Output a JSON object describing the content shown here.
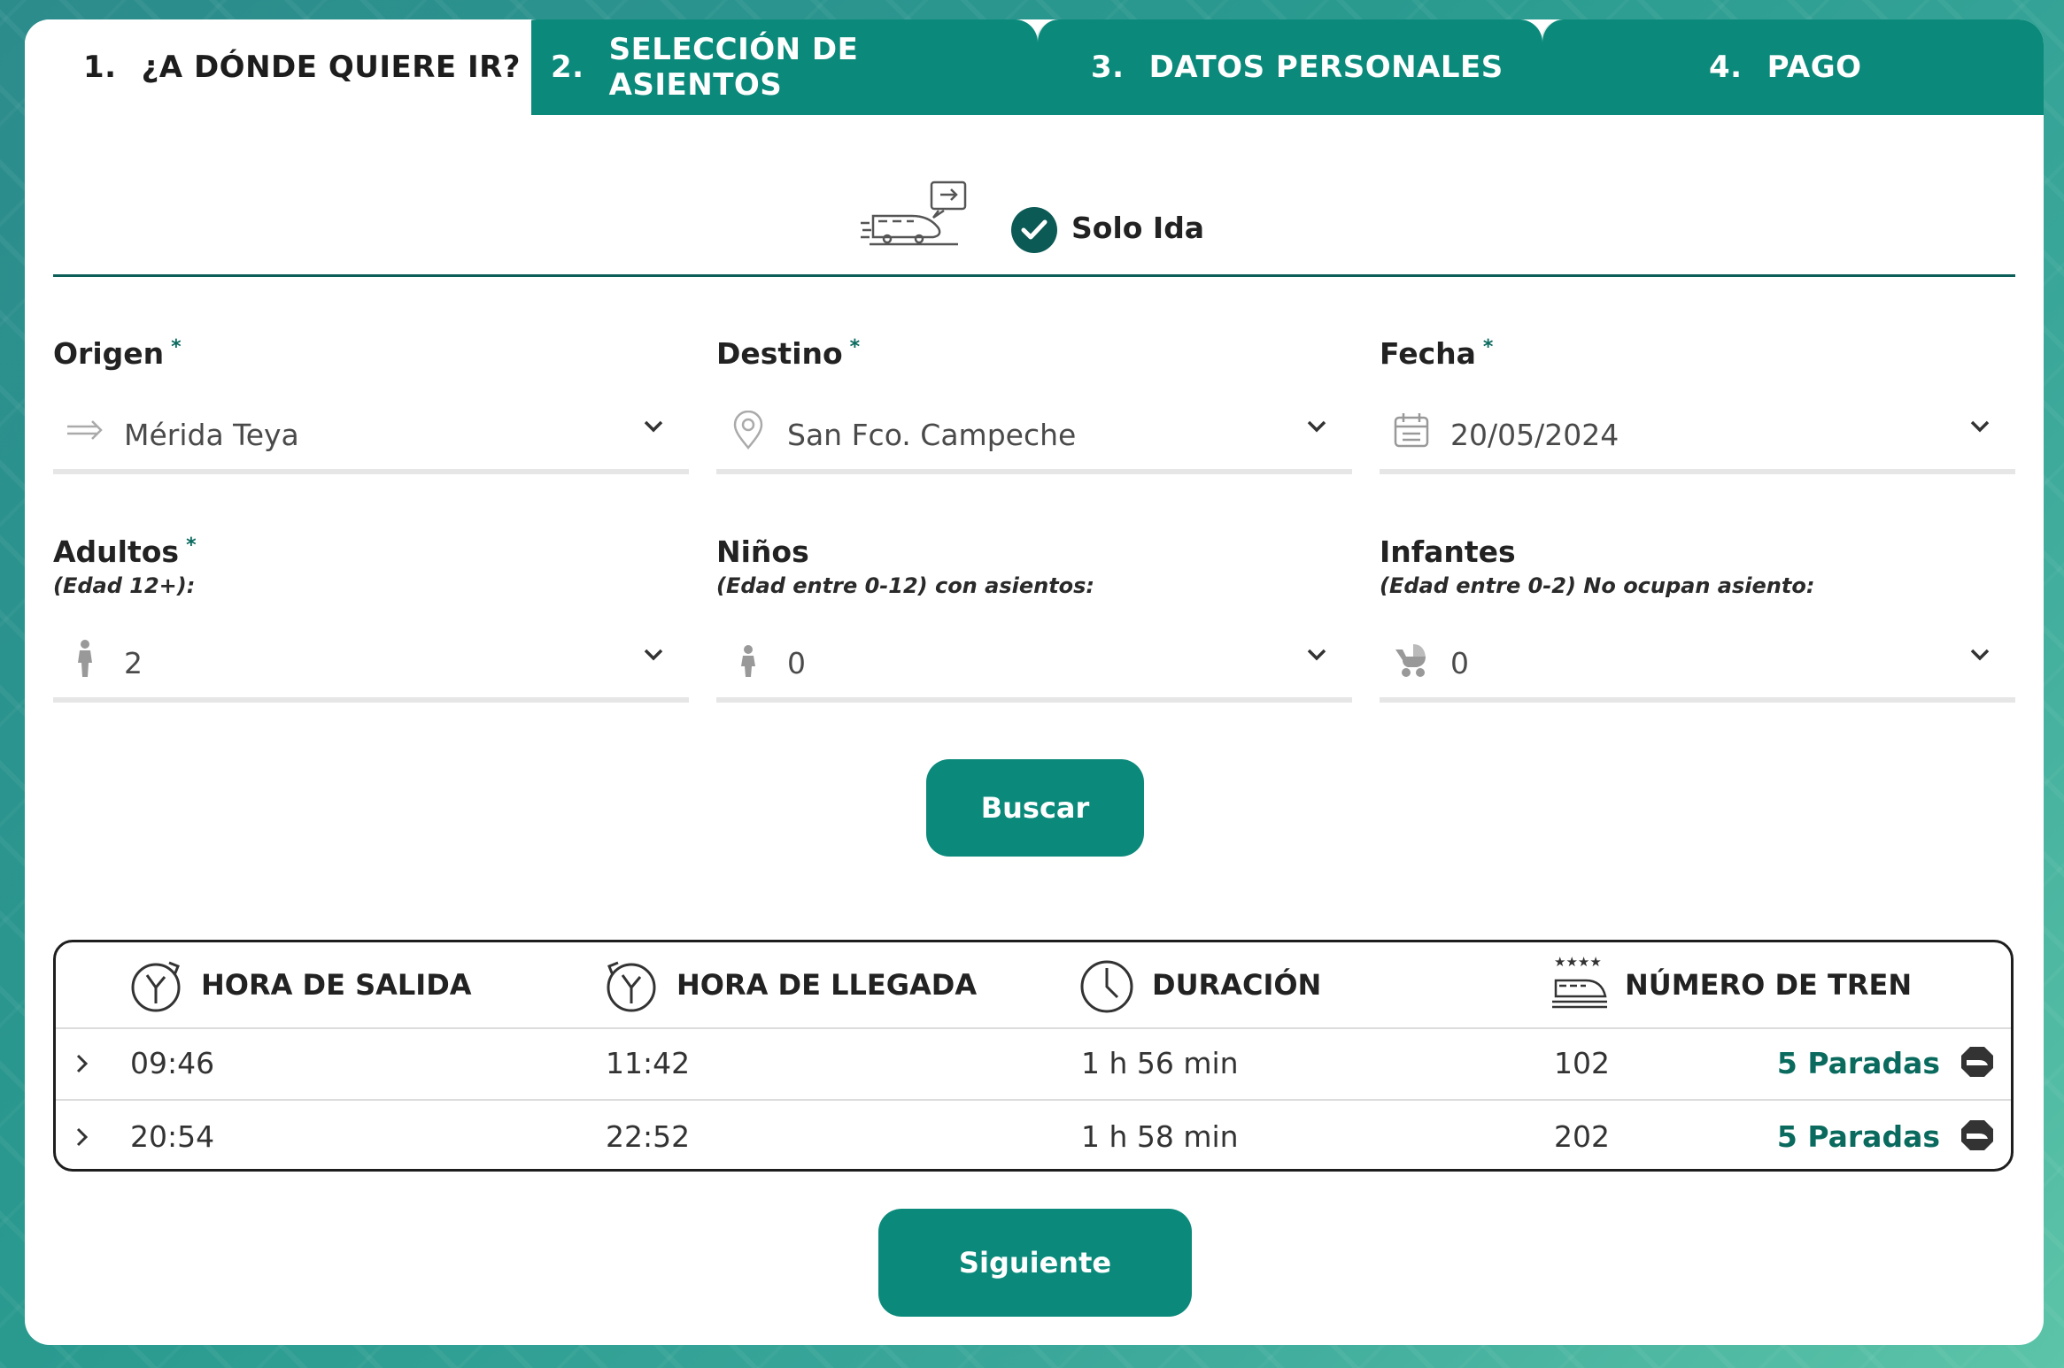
{
  "tabs": [
    {
      "num": "1.",
      "label": "¿A DÓNDE QUIERE IR?"
    },
    {
      "num": "2.",
      "label": "SELECCIÓN DE ASIENTOS"
    },
    {
      "num": "3.",
      "label": "DATOS PERSONALES"
    },
    {
      "num": "4.",
      "label": "PAGO"
    }
  ],
  "trip_type": {
    "label": "Solo Ida",
    "checked": true
  },
  "form": {
    "origen": {
      "label": "Origen",
      "required": "*",
      "value": "Mérida Teya"
    },
    "destino": {
      "label": "Destino",
      "required": "*",
      "value": "San Fco. Campeche"
    },
    "fecha": {
      "label": "Fecha",
      "required": "*",
      "value": "20/05/2024"
    },
    "adultos": {
      "label": "Adultos",
      "required": "*",
      "sub": "(Edad 12+):",
      "value": "2"
    },
    "ninos": {
      "label": "Niños",
      "sub": "(Edad entre 0-12) con asientos:",
      "value": "0"
    },
    "infantes": {
      "label": "Infantes",
      "sub": "(Edad entre 0-2) No ocupan asiento:",
      "value": "0"
    }
  },
  "buttons": {
    "buscar": "Buscar",
    "siguiente": "Siguiente"
  },
  "results": {
    "headers": {
      "salida": "HORA DE SALIDA",
      "llegada": "HORA DE LLEGADA",
      "duracion": "DURACIÓN",
      "tren": "NÚMERO DE TREN",
      "tren_stars": "★★★★"
    },
    "rows": [
      {
        "salida": "09:46",
        "llegada": "11:42",
        "duracion": "1 h 56 min",
        "tren": "102",
        "paradas": "5 Paradas"
      },
      {
        "salida": "20:54",
        "llegada": "22:52",
        "duracion": "1 h 58 min",
        "tren": "202",
        "paradas": "5 Paradas"
      }
    ]
  },
  "colors": {
    "brand": "#0b8a7b",
    "dark_teal": "#0c5a55",
    "paradas": "#0a6a5e"
  }
}
